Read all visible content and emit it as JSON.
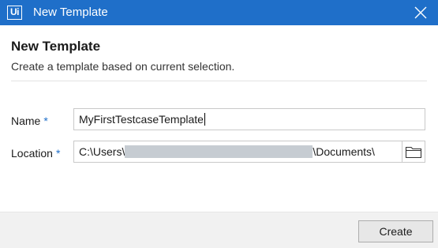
{
  "window": {
    "app_logo_text": "Ui",
    "title": "New Template",
    "accent_color": "#1f6fc9"
  },
  "header": {
    "heading": "New Template",
    "subheading": "Create a template based on current selection."
  },
  "form": {
    "name": {
      "label": "Name",
      "required_marker": "*",
      "value": "MyFirstTestcaseTemplate"
    },
    "location": {
      "label": "Location",
      "required_marker": "*",
      "value_prefix": "C:\\Users\\",
      "value_suffix": "\\Documents\\",
      "browse_icon": "folder-icon"
    }
  },
  "footer": {
    "create_label": "Create"
  }
}
